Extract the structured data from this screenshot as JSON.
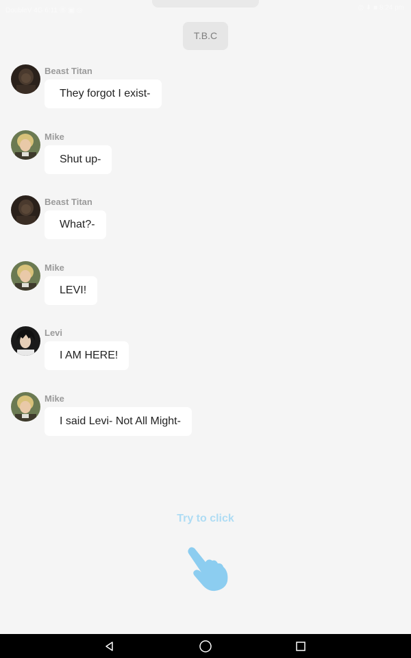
{
  "status_bar": {
    "left_text": "DoubleV 4G 6:11 Ⓑ ▣ ◎",
    "right_text": "◎ ⬇ ■ 8:24 pm"
  },
  "chapter_chip": "T.B.C",
  "messages": [
    {
      "sender": "Beast Titan",
      "text": "They forgot I exist-",
      "avatar": "beast-titan-avatar"
    },
    {
      "sender": "Mike",
      "text": "Shut up-",
      "avatar": "mike-avatar"
    },
    {
      "sender": "Beast Titan",
      "text": "What?-",
      "avatar": "beast-titan-avatar"
    },
    {
      "sender": "Mike",
      "text": "LEVI!",
      "avatar": "mike-avatar"
    },
    {
      "sender": "Levi",
      "text": "I AM HERE!",
      "avatar": "levi-avatar"
    },
    {
      "sender": "Mike",
      "text": "I said Levi- Not All Might-",
      "avatar": "mike-avatar"
    }
  ],
  "hint": {
    "label": "Try to click",
    "icon": "tap-hand-icon"
  },
  "colors": {
    "background": "#f5f5f5",
    "bubble": "#ffffff",
    "chip": "#e6e6e6",
    "hint": "#aedcf4",
    "nav_bar": "#000000"
  },
  "nav_bar": {
    "back_icon": "back-triangle-icon",
    "home_icon": "home-circle-icon",
    "recents_icon": "recents-square-icon"
  }
}
